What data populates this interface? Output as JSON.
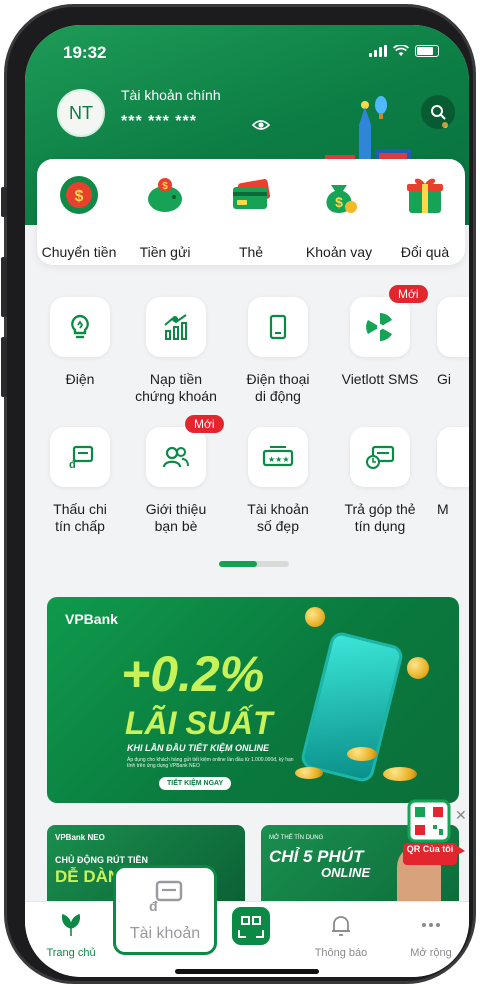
{
  "status_bar": {
    "time": "19:32"
  },
  "account": {
    "avatar_initials": "NT",
    "name": "Tài khoản chính",
    "balance_masked": "*** *** ***"
  },
  "quick_actions": [
    {
      "label": "Chuyển tiền",
      "icon": "money-transfer-icon"
    },
    {
      "label": "Tiền gửi",
      "icon": "piggy-bank-icon"
    },
    {
      "label": "Thẻ",
      "icon": "card-icon"
    },
    {
      "label": "Khoản vay",
      "icon": "money-bag-icon"
    },
    {
      "label": "Đổi quà",
      "icon": "gift-icon"
    }
  ],
  "services_row1": [
    {
      "label": "Điện",
      "icon": "lightbulb-icon"
    },
    {
      "label": "Nạp tiền\nchứng khoán",
      "icon": "stock-chart-icon"
    },
    {
      "label": "Điện thoại\ndi động",
      "icon": "phone-icon"
    },
    {
      "label": "Vietlott SMS",
      "icon": "vietlott-icon",
      "badge": "Mới"
    },
    {
      "label": "Gi",
      "icon": "partial-icon"
    }
  ],
  "services_row2": [
    {
      "label": "Thấu chi\ntín chấp",
      "icon": "overdraft-icon"
    },
    {
      "label": "Giới thiệu\nbạn bè",
      "icon": "people-icon",
      "badge": "Mới"
    },
    {
      "label": "Tài khoản\nsố đẹp",
      "icon": "nice-number-icon"
    },
    {
      "label": "Trả góp thẻ\ntín dụng",
      "icon": "installment-icon"
    },
    {
      "label": "M",
      "icon": "partial-icon"
    }
  ],
  "banner": {
    "brand": "VPBank",
    "rate": "+0.2%",
    "title": "LÃI SUẤT",
    "subtitle": "KHI LẦN ĐẦU TIẾT KIỆM ONLINE",
    "note": "Áp dụng cho khách hàng gửi tiết kiệm online lần đầu từ 1.000.000đ, kỳ hạn tính trên ứng dụng VPBank NEO",
    "cta": "TIẾT KIỆM NGAY"
  },
  "promos": [
    {
      "brand": "VPBank NEO",
      "line1": "CHỦ ĐỘNG RÚT TIỀN",
      "line2": "DỄ DÀNG"
    },
    {
      "line0": "MỞ THẺ TÍN DỤNG",
      "line1": "CHỈ 5 PHÚT",
      "line2": "ONLINE"
    }
  ],
  "qr_float": {
    "label": "QR Của tôi"
  },
  "popup": {
    "label": "Tài khoản"
  },
  "tabbar": {
    "home": "Trang chủ",
    "notifications": "Thông báo",
    "more": "Mở rộng"
  },
  "colors": {
    "brand_green": "#0b8a46",
    "badge_red": "#e3262d",
    "accent_lime": "#c8f25a"
  }
}
